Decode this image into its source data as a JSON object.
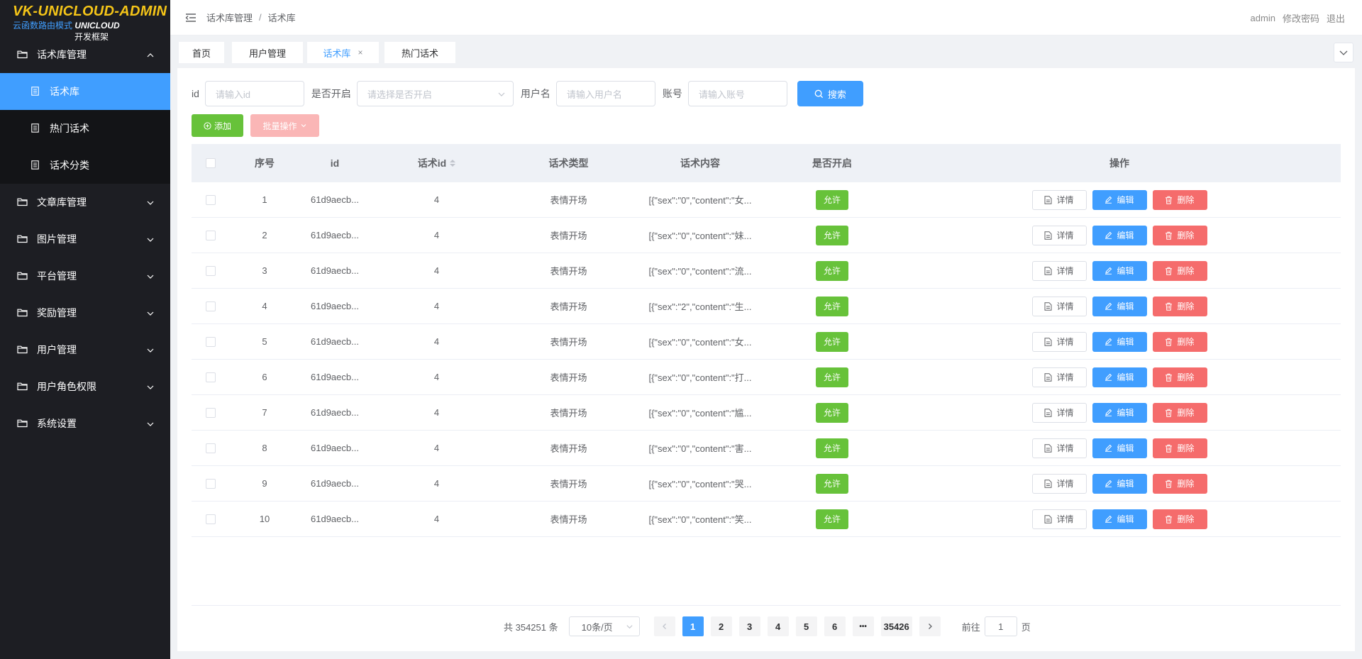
{
  "logo": {
    "title": "VK-UNICLOUD-ADMIN",
    "sub_a": "云函数路由模式",
    "sub_b": "UNICLOUD",
    "sub_c": "开发框架"
  },
  "sidebar": {
    "groups": [
      {
        "label": "话术库管理",
        "icon": "folder-icon",
        "expanded": true,
        "children": [
          {
            "label": "话术库",
            "icon": "document-icon",
            "active": true
          },
          {
            "label": "热门话术",
            "icon": "document-icon",
            "active": false
          },
          {
            "label": "话术分类",
            "icon": "document-icon",
            "active": false
          }
        ]
      },
      {
        "label": "文章库管理",
        "icon": "folder-icon"
      },
      {
        "label": "图片管理",
        "icon": "folder-icon"
      },
      {
        "label": "平台管理",
        "icon": "folder-icon"
      },
      {
        "label": "奖励管理",
        "icon": "folder-icon"
      },
      {
        "label": "用户管理",
        "icon": "folder-icon"
      },
      {
        "label": "用户角色权限",
        "icon": "folder-icon"
      },
      {
        "label": "系统设置",
        "icon": "folder-icon"
      }
    ]
  },
  "header": {
    "breadcrumb": [
      "话术库管理",
      "话术库"
    ],
    "breadcrumb_sep": "/",
    "user": "admin",
    "change_password": "修改密码",
    "logout": "退出"
  },
  "tabs": [
    {
      "label": "首页"
    },
    {
      "label": "用户管理"
    },
    {
      "label": "话术库",
      "active": true,
      "close": "×"
    },
    {
      "label": "热门话术"
    }
  ],
  "filters": {
    "id_label": "id",
    "id_placeholder": "请输入id",
    "open_label": "是否开启",
    "open_placeholder": "请选择是否开启",
    "username_label": "用户名",
    "username_placeholder": "请输入用户名",
    "account_label": "账号",
    "account_placeholder": "请输入账号",
    "search_label": "搜索"
  },
  "toolbar": {
    "add_label": "添加",
    "batch_label": "批量操作"
  },
  "table": {
    "headers": {
      "no": "序号",
      "id": "id",
      "script_id": "话术id",
      "type": "话术类型",
      "content": "话术内容",
      "open": "是否开启",
      "ops": "操作"
    },
    "rows": [
      {
        "no": "1",
        "id": "61d9aecb...",
        "script_id": "4",
        "type": "表情开场",
        "content": "[{\"sex\":\"0\",\"content\":\"女...",
        "open": "允许"
      },
      {
        "no": "2",
        "id": "61d9aecb...",
        "script_id": "4",
        "type": "表情开场",
        "content": "[{\"sex\":\"0\",\"content\":\"妹...",
        "open": "允许"
      },
      {
        "no": "3",
        "id": "61d9aecb...",
        "script_id": "4",
        "type": "表情开场",
        "content": "[{\"sex\":\"0\",\"content\":\"流...",
        "open": "允许"
      },
      {
        "no": "4",
        "id": "61d9aecb...",
        "script_id": "4",
        "type": "表情开场",
        "content": "[{\"sex\":\"2\",\"content\":\"生...",
        "open": "允许"
      },
      {
        "no": "5",
        "id": "61d9aecb...",
        "script_id": "4",
        "type": "表情开场",
        "content": "[{\"sex\":\"0\",\"content\":\"女...",
        "open": "允许"
      },
      {
        "no": "6",
        "id": "61d9aecb...",
        "script_id": "4",
        "type": "表情开场",
        "content": "[{\"sex\":\"0\",\"content\":\"打...",
        "open": "允许"
      },
      {
        "no": "7",
        "id": "61d9aecb...",
        "script_id": "4",
        "type": "表情开场",
        "content": "[{\"sex\":\"0\",\"content\":\"尴...",
        "open": "允许"
      },
      {
        "no": "8",
        "id": "61d9aecb...",
        "script_id": "4",
        "type": "表情开场",
        "content": "[{\"sex\":\"0\",\"content\":\"害...",
        "open": "允许"
      },
      {
        "no": "9",
        "id": "61d9aecb...",
        "script_id": "4",
        "type": "表情开场",
        "content": "[{\"sex\":\"0\",\"content\":\"哭...",
        "open": "允许"
      },
      {
        "no": "10",
        "id": "61d9aecb...",
        "script_id": "4",
        "type": "表情开场",
        "content": "[{\"sex\":\"0\",\"content\":\"笑...",
        "open": "允许"
      }
    ],
    "ops": {
      "detail": "详情",
      "edit": "编辑",
      "delete": "删除"
    }
  },
  "pagination": {
    "total_text": "共 354251 条",
    "page_size": "10条/页",
    "pages": [
      "1",
      "2",
      "3",
      "4",
      "5",
      "6"
    ],
    "ellipsis": "•••",
    "last_page": "35426",
    "current": "1",
    "goto_label": "前往",
    "goto_value": "1",
    "page_suffix": "页"
  },
  "colors": {
    "primary": "#409eff",
    "success": "#67c23a",
    "danger": "#f56c6c",
    "sidebar": "#1d1e23",
    "logo": "#f5c518"
  }
}
